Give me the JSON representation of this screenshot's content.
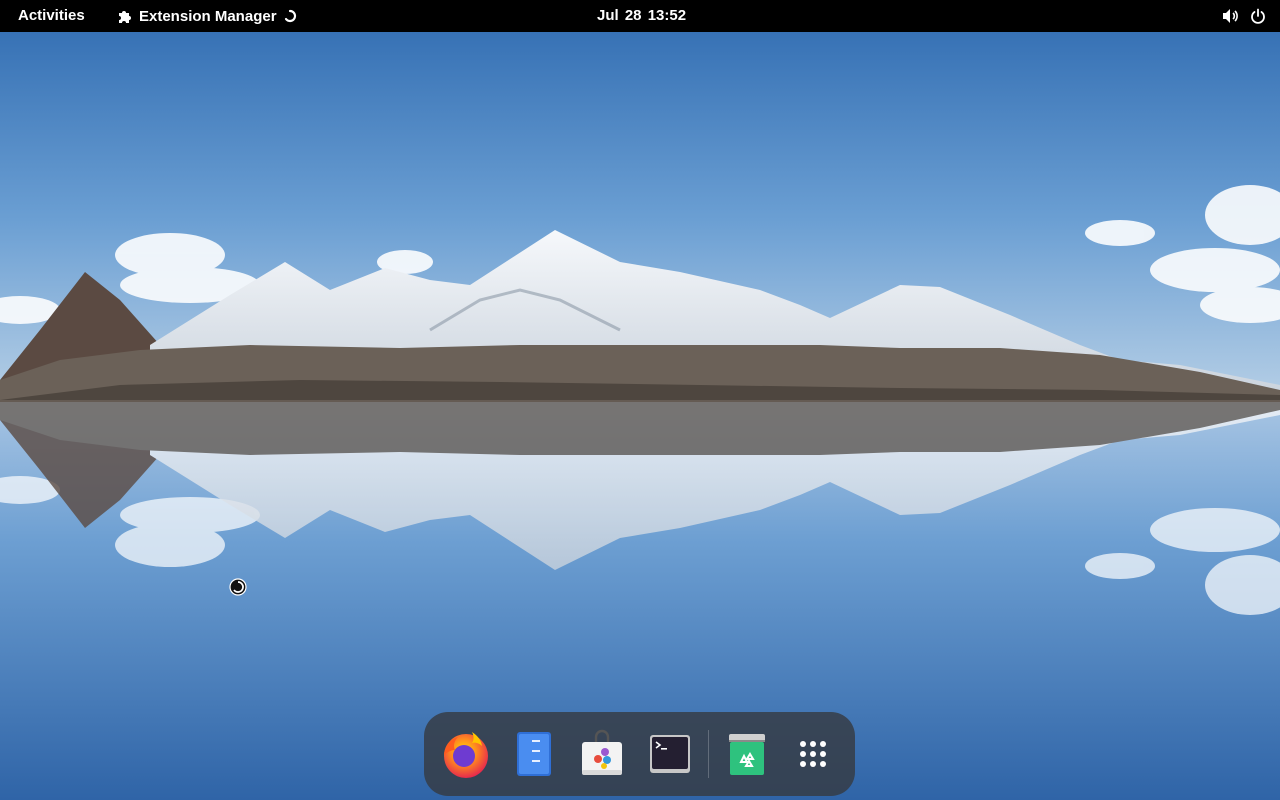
{
  "topbar": {
    "activities_label": "Activities",
    "app_menu_label": "Extension Manager",
    "clock": "Jul 28  13:52"
  },
  "dock": {
    "apps": [
      {
        "name": "Firefox",
        "icon": "firefox-icon"
      },
      {
        "name": "Text Editor",
        "icon": "text-editor-icon"
      },
      {
        "name": "Software",
        "icon": "software-icon"
      },
      {
        "name": "Terminal",
        "icon": "terminal-icon"
      },
      {
        "name": "Trash",
        "icon": "trash-icon"
      },
      {
        "name": "Show Applications",
        "icon": "app-grid-icon"
      }
    ]
  },
  "colors": {
    "topbar_bg": "#000000",
    "dock_bg": "#363a42",
    "sky": "#3e78b8"
  }
}
